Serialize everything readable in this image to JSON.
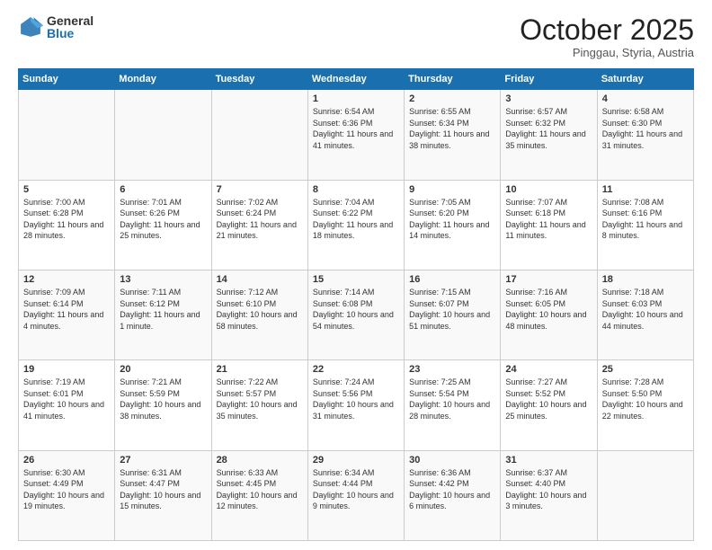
{
  "header": {
    "logo_general": "General",
    "logo_blue": "Blue",
    "month_title": "October 2025",
    "subtitle": "Pinggau, Styria, Austria"
  },
  "days_of_week": [
    "Sunday",
    "Monday",
    "Tuesday",
    "Wednesday",
    "Thursday",
    "Friday",
    "Saturday"
  ],
  "weeks": [
    [
      {
        "day": "",
        "text": ""
      },
      {
        "day": "",
        "text": ""
      },
      {
        "day": "",
        "text": ""
      },
      {
        "day": "1",
        "text": "Sunrise: 6:54 AM\nSunset: 6:36 PM\nDaylight: 11 hours and 41 minutes."
      },
      {
        "day": "2",
        "text": "Sunrise: 6:55 AM\nSunset: 6:34 PM\nDaylight: 11 hours and 38 minutes."
      },
      {
        "day": "3",
        "text": "Sunrise: 6:57 AM\nSunset: 6:32 PM\nDaylight: 11 hours and 35 minutes."
      },
      {
        "day": "4",
        "text": "Sunrise: 6:58 AM\nSunset: 6:30 PM\nDaylight: 11 hours and 31 minutes."
      }
    ],
    [
      {
        "day": "5",
        "text": "Sunrise: 7:00 AM\nSunset: 6:28 PM\nDaylight: 11 hours and 28 minutes."
      },
      {
        "day": "6",
        "text": "Sunrise: 7:01 AM\nSunset: 6:26 PM\nDaylight: 11 hours and 25 minutes."
      },
      {
        "day": "7",
        "text": "Sunrise: 7:02 AM\nSunset: 6:24 PM\nDaylight: 11 hours and 21 minutes."
      },
      {
        "day": "8",
        "text": "Sunrise: 7:04 AM\nSunset: 6:22 PM\nDaylight: 11 hours and 18 minutes."
      },
      {
        "day": "9",
        "text": "Sunrise: 7:05 AM\nSunset: 6:20 PM\nDaylight: 11 hours and 14 minutes."
      },
      {
        "day": "10",
        "text": "Sunrise: 7:07 AM\nSunset: 6:18 PM\nDaylight: 11 hours and 11 minutes."
      },
      {
        "day": "11",
        "text": "Sunrise: 7:08 AM\nSunset: 6:16 PM\nDaylight: 11 hours and 8 minutes."
      }
    ],
    [
      {
        "day": "12",
        "text": "Sunrise: 7:09 AM\nSunset: 6:14 PM\nDaylight: 11 hours and 4 minutes."
      },
      {
        "day": "13",
        "text": "Sunrise: 7:11 AM\nSunset: 6:12 PM\nDaylight: 11 hours and 1 minute."
      },
      {
        "day": "14",
        "text": "Sunrise: 7:12 AM\nSunset: 6:10 PM\nDaylight: 10 hours and 58 minutes."
      },
      {
        "day": "15",
        "text": "Sunrise: 7:14 AM\nSunset: 6:08 PM\nDaylight: 10 hours and 54 minutes."
      },
      {
        "day": "16",
        "text": "Sunrise: 7:15 AM\nSunset: 6:07 PM\nDaylight: 10 hours and 51 minutes."
      },
      {
        "day": "17",
        "text": "Sunrise: 7:16 AM\nSunset: 6:05 PM\nDaylight: 10 hours and 48 minutes."
      },
      {
        "day": "18",
        "text": "Sunrise: 7:18 AM\nSunset: 6:03 PM\nDaylight: 10 hours and 44 minutes."
      }
    ],
    [
      {
        "day": "19",
        "text": "Sunrise: 7:19 AM\nSunset: 6:01 PM\nDaylight: 10 hours and 41 minutes."
      },
      {
        "day": "20",
        "text": "Sunrise: 7:21 AM\nSunset: 5:59 PM\nDaylight: 10 hours and 38 minutes."
      },
      {
        "day": "21",
        "text": "Sunrise: 7:22 AM\nSunset: 5:57 PM\nDaylight: 10 hours and 35 minutes."
      },
      {
        "day": "22",
        "text": "Sunrise: 7:24 AM\nSunset: 5:56 PM\nDaylight: 10 hours and 31 minutes."
      },
      {
        "day": "23",
        "text": "Sunrise: 7:25 AM\nSunset: 5:54 PM\nDaylight: 10 hours and 28 minutes."
      },
      {
        "day": "24",
        "text": "Sunrise: 7:27 AM\nSunset: 5:52 PM\nDaylight: 10 hours and 25 minutes."
      },
      {
        "day": "25",
        "text": "Sunrise: 7:28 AM\nSunset: 5:50 PM\nDaylight: 10 hours and 22 minutes."
      }
    ],
    [
      {
        "day": "26",
        "text": "Sunrise: 6:30 AM\nSunset: 4:49 PM\nDaylight: 10 hours and 19 minutes."
      },
      {
        "day": "27",
        "text": "Sunrise: 6:31 AM\nSunset: 4:47 PM\nDaylight: 10 hours and 15 minutes."
      },
      {
        "day": "28",
        "text": "Sunrise: 6:33 AM\nSunset: 4:45 PM\nDaylight: 10 hours and 12 minutes."
      },
      {
        "day": "29",
        "text": "Sunrise: 6:34 AM\nSunset: 4:44 PM\nDaylight: 10 hours and 9 minutes."
      },
      {
        "day": "30",
        "text": "Sunrise: 6:36 AM\nSunset: 4:42 PM\nDaylight: 10 hours and 6 minutes."
      },
      {
        "day": "31",
        "text": "Sunrise: 6:37 AM\nSunset: 4:40 PM\nDaylight: 10 hours and 3 minutes."
      },
      {
        "day": "",
        "text": ""
      }
    ]
  ]
}
